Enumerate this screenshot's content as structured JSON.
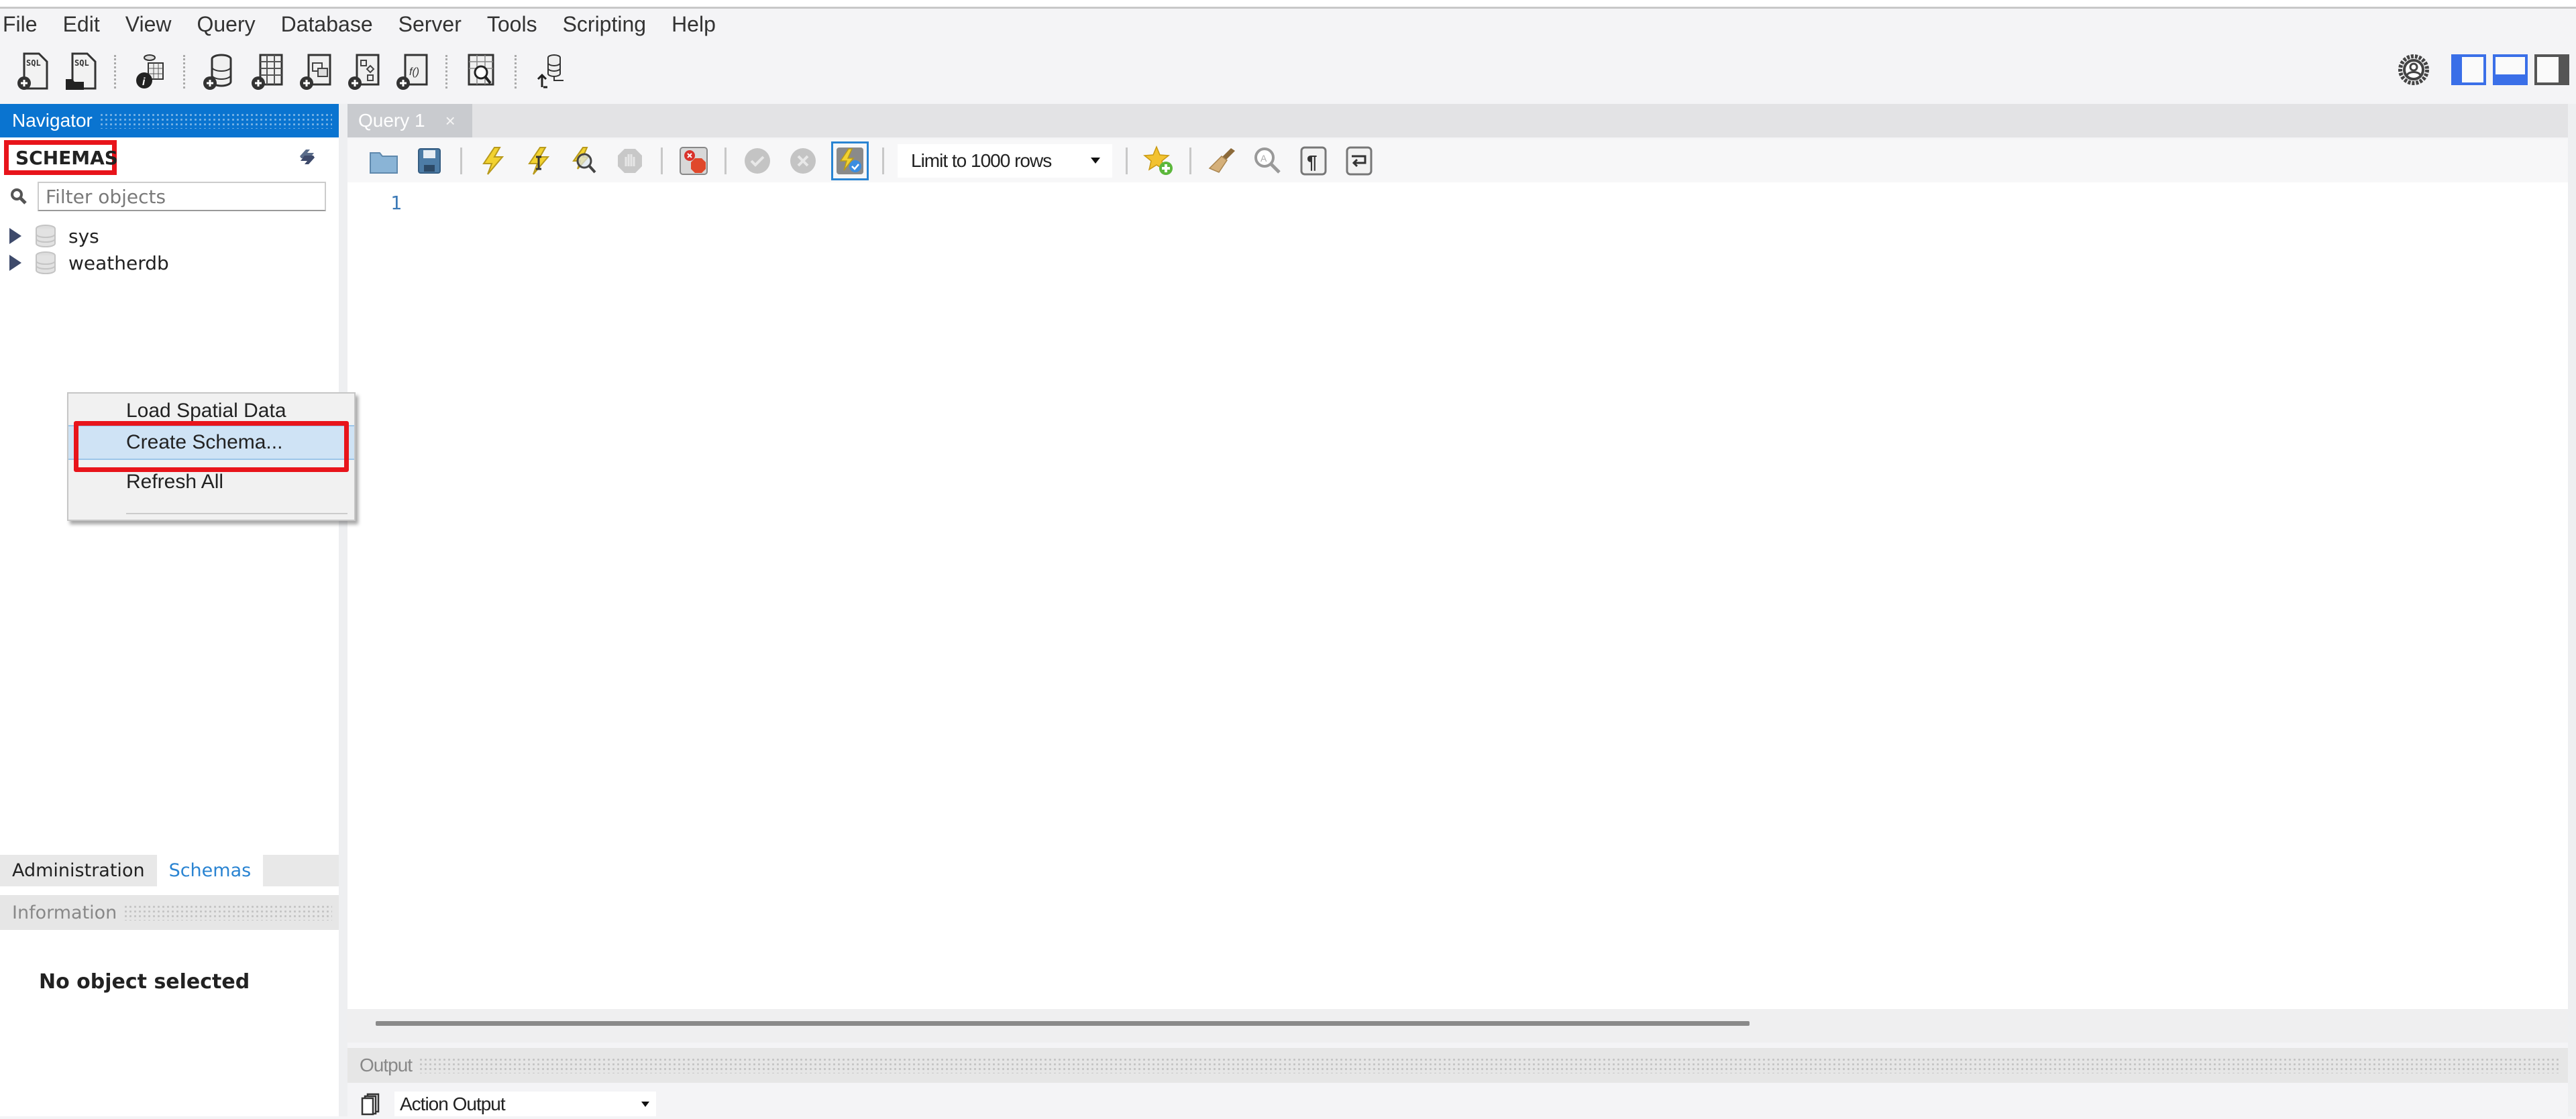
{
  "menu": [
    "File",
    "Edit",
    "View",
    "Query",
    "Database",
    "Server",
    "Tools",
    "Scripting",
    "Help"
  ],
  "main_toolbar": {
    "icons": [
      {
        "name": "new-sql-tab-icon",
        "title": "SQL"
      },
      {
        "name": "open-sql-script-icon",
        "title": "SQL"
      },
      {
        "name": "schema-inspector-icon"
      },
      {
        "name": "create-schema-icon"
      },
      {
        "name": "create-table-icon"
      },
      {
        "name": "create-view-icon"
      },
      {
        "name": "create-procedure-icon"
      },
      {
        "name": "create-function-icon"
      },
      {
        "name": "search-table-data-icon"
      },
      {
        "name": "reconnect-icon"
      }
    ]
  },
  "layout_controls": [
    "preferences-gear-icon",
    "toggle-sidebar-icon",
    "toggle-output-icon",
    "toggle-secondary-sidebar-icon"
  ],
  "navigator": {
    "title": "Navigator",
    "section": "SCHEMAS",
    "filter_placeholder": "Filter objects",
    "schemas": [
      "sys",
      "weatherdb"
    ]
  },
  "context_menu": {
    "items": [
      {
        "label": "Load Spatial Data",
        "highlighted": false
      },
      {
        "label": "Create Schema...",
        "highlighted": true
      },
      {
        "label": "Refresh All",
        "highlighted": false
      }
    ]
  },
  "bottom_tabs": [
    {
      "label": "Administration",
      "active": false
    },
    {
      "label": "Schemas",
      "active": true
    }
  ],
  "information": {
    "title": "Information",
    "message": "No object selected"
  },
  "query": {
    "tab_label": "Query 1",
    "tab_close": "×",
    "limit_option": "Limit to 1000 rows",
    "line_numbers": [
      "1"
    ]
  },
  "output": {
    "title": "Output",
    "selected_view": "Action Output"
  },
  "colors": {
    "accent": "#0a74d0",
    "highlight_box": "#e8141b",
    "menu_selection": "#cfe3f5",
    "active_tab_text": "#2a84d2"
  }
}
